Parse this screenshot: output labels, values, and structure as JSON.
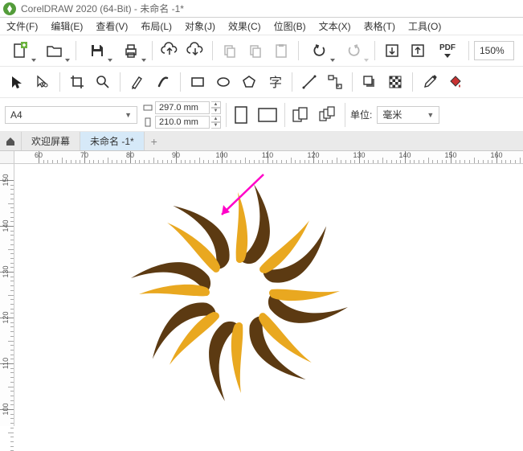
{
  "titlebar": {
    "title": "CorelDRAW 2020 (64-Bit) - 未命名 -1*"
  },
  "menu": {
    "file": "文件(F)",
    "edit": "编辑(E)",
    "view": "查看(V)",
    "layout": "布局(L)",
    "object": "对象(J)",
    "effects": "效果(C)",
    "bitmap": "位图(B)",
    "text": "文本(X)",
    "table": "表格(T)",
    "tools": "工具(O)"
  },
  "toolbar1": {
    "zoom": "150%",
    "pdf_label": "PDF"
  },
  "propbar": {
    "paper": "A4",
    "width": "297.0 mm",
    "height": "210.0 mm",
    "units_label": "单位:",
    "units_value": "毫米"
  },
  "tabs": {
    "welcome": "欢迎屏幕",
    "doc": "未命名 -1*"
  },
  "ruler_h": [
    "60",
    "70",
    "80",
    "90",
    "100",
    "110",
    "120",
    "130",
    "140",
    "150",
    "160"
  ],
  "ruler_v": [
    "150",
    "140",
    "130",
    "120",
    "110",
    "100"
  ]
}
